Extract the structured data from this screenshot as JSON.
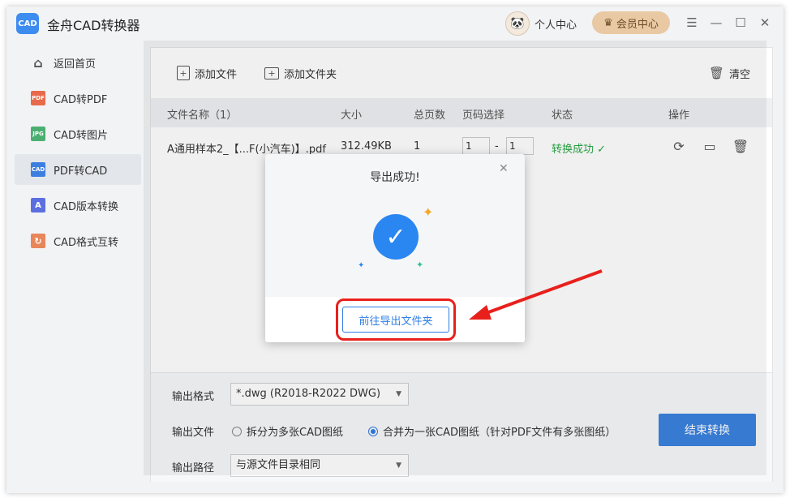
{
  "app": {
    "title": "金舟CAD转换器",
    "logo_text": "CAD"
  },
  "titlebar": {
    "user_center": "个人中心",
    "vip_center": "会员中心"
  },
  "sidebar": {
    "items": [
      {
        "label": "返回首页",
        "icon": "home-icon"
      },
      {
        "label": "CAD转PDF",
        "icon": "pdf-icon",
        "badge": "PDF",
        "color": "#e86a4a"
      },
      {
        "label": "CAD转图片",
        "icon": "image-icon",
        "badge": "JPG",
        "color": "#4caf72"
      },
      {
        "label": "PDF转CAD",
        "icon": "cad-icon",
        "badge": "CAD",
        "color": "#3d7fe0",
        "active": true
      },
      {
        "label": "CAD版本转换",
        "icon": "version-icon",
        "badge": "A",
        "color": "#5b6fe0"
      },
      {
        "label": "CAD格式互转",
        "icon": "format-icon",
        "badge": "↻",
        "color": "#e8865a"
      }
    ]
  },
  "toolbar": {
    "add_file": "添加文件",
    "add_folder": "添加文件夹",
    "clear": "清空"
  },
  "table": {
    "headers": {
      "name": "文件名称（1）",
      "size": "大小",
      "pages": "总页数",
      "page_select": "页码选择",
      "status": "状态",
      "actions": "操作"
    },
    "rows": [
      {
        "name": "A通用样本2_【...F(小汽车)】.pdf",
        "size": "312.49KB",
        "pages": "1",
        "page_from": "1",
        "page_to": "1",
        "status": "转换成功 ✓"
      }
    ]
  },
  "footer": {
    "format_label": "输出格式",
    "format_value": "*.dwg (R2018-R2022 DWG)",
    "file_label": "输出文件",
    "option_split": "拆分为多张CAD图纸",
    "option_merge": "合并为一张CAD图纸（针对PDF文件有多张图纸）",
    "path_label": "输出路径",
    "path_value": "与源文件目录相同",
    "end_button": "结束转换"
  },
  "dialog": {
    "title": "导出成功!",
    "button": "前往导出文件夹"
  },
  "colors": {
    "accent": "#2f7ee6",
    "success": "#28a745",
    "highlight": "#e8201c"
  }
}
